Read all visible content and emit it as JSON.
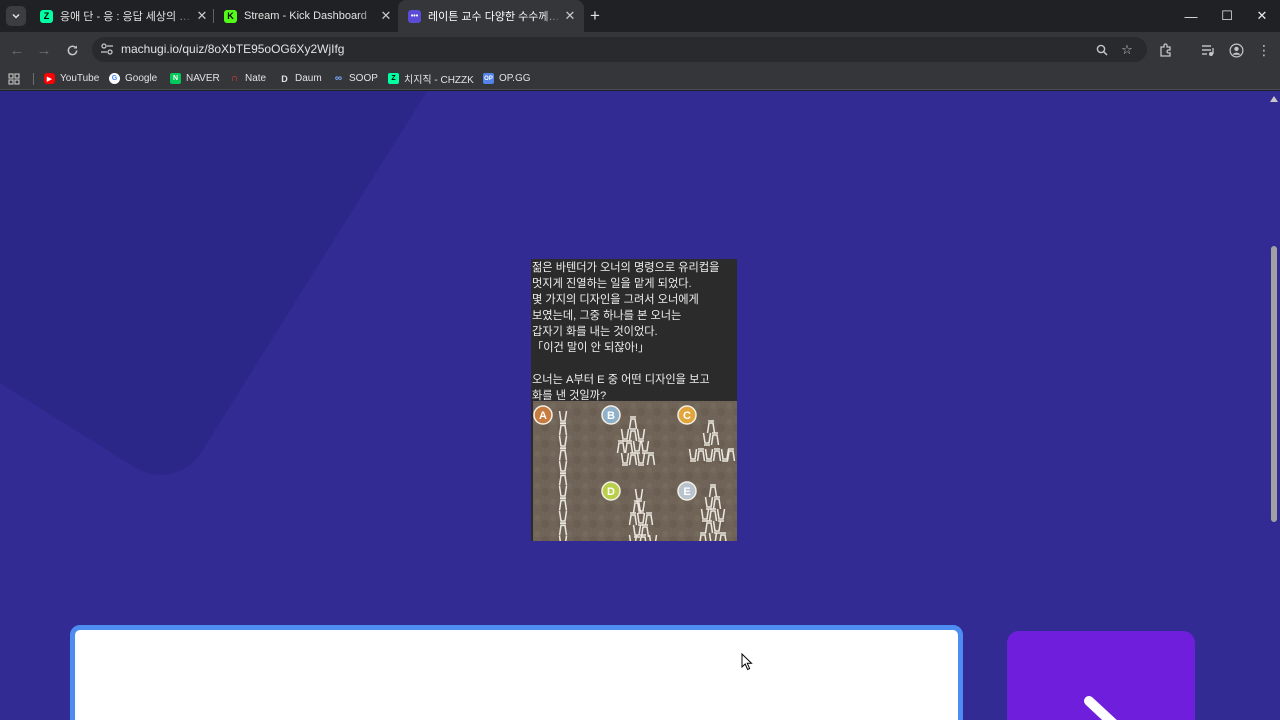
{
  "tabs": [
    {
      "title": "응애 단 - 응 : 응답 세상의 주인",
      "favicon": "chzzk-icon",
      "color": "#00ffa3",
      "letter": "Z",
      "active": false
    },
    {
      "title": "Stream - Kick Dashboard",
      "favicon": "kick-icon",
      "color": "#53fc18",
      "letter": "K",
      "active": false
    },
    {
      "title": "레이튼 교수 다양한 수수께끼 (",
      "favicon": "machugi-icon",
      "color": "#5b4bd6",
      "letter": "•••",
      "active": true
    }
  ],
  "window": {
    "minimize": "—",
    "maximize": "☐",
    "close": "✕"
  },
  "address": {
    "url": "machugi.io/quiz/8oXbTE95oOG6Xy2WjIfg"
  },
  "bookmarks": [
    {
      "label": "YouTube",
      "color": "#ff0000",
      "icon": "youtube-icon"
    },
    {
      "label": "Google",
      "color": "#4285f4",
      "icon": "google-icon"
    },
    {
      "label": "NAVER",
      "color": "#03c75a",
      "icon": "naver-icon"
    },
    {
      "label": "Nate",
      "color": "#ff3b30",
      "icon": "nate-icon"
    },
    {
      "label": "Daum",
      "color": "#2a2a2a",
      "icon": "daum-icon"
    },
    {
      "label": "SOOP",
      "color": "#1f6feb",
      "icon": "soop-icon"
    },
    {
      "label": "치지직 - CHZZK",
      "color": "#00ffa3",
      "icon": "chzzk-icon"
    },
    {
      "label": "OP.GG",
      "color": "#5383e8",
      "icon": "opgg-icon"
    }
  ],
  "quiz": {
    "question_text": "젊은 바텐더가 오너의 명령으로 유리컵을\n멋지게 진열하는 일을 맡게 되었다.\n몇 가지의 디자인을 그려서 오너에게\n보였는데, 그중 하나를 본 오너는\n갑자기 화를 내는 것이었다.\n「이건 말이 안 되잖아!」\n\n오너는 A부터 E 중 어떤 디자인을 보고\n화를 낸 것일까?",
    "options": [
      "A",
      "B",
      "C",
      "D",
      "E"
    ]
  },
  "colors": {
    "page_bg": "#312b93",
    "input_border": "#4d8df2",
    "submit_bg": "#6f1fdc"
  }
}
